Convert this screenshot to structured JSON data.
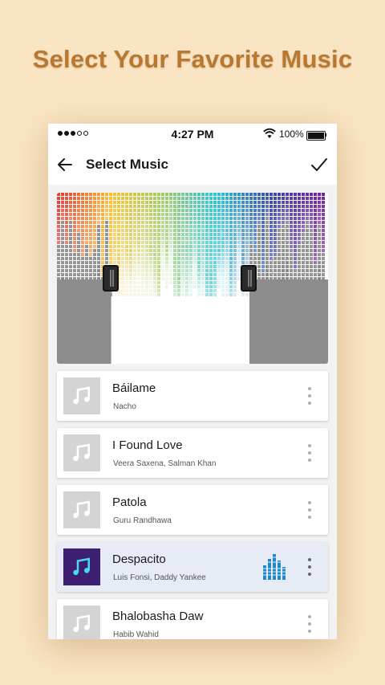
{
  "promo": {
    "title": "Select Your Favorite Music"
  },
  "status_bar": {
    "time": "4:27 PM",
    "battery": "100%",
    "signal_icon": "signal-dots",
    "wifi_icon": "wifi-icon",
    "battery_icon": "battery-icon"
  },
  "app_bar": {
    "title": "Select Music",
    "back_icon": "arrow-left-icon",
    "confirm_icon": "check-icon"
  },
  "waveform": {
    "selection_start": 0.2,
    "selection_end": 0.71,
    "colors": [
      "#e53935",
      "#fbc02d",
      "#9ccc65",
      "#26c6da",
      "#3949ab",
      "#7b1fa2"
    ]
  },
  "songs": [
    {
      "title": "Báilame",
      "artist": "Nacho",
      "playing": false
    },
    {
      "title": "I Found Love",
      "artist": "Veera Saxena, Salman Khan",
      "playing": false
    },
    {
      "title": "Patola",
      "artist": "Guru Randhawa",
      "playing": false
    },
    {
      "title": "Despacito",
      "artist": "Luis Fonsi, Daddy Yankee",
      "playing": true
    },
    {
      "title": "Bhalobasha Daw",
      "artist": "Habib Wahid",
      "playing": false
    }
  ],
  "colors": {
    "accent": "#1e88c8",
    "promo_text": "#b8782f",
    "background": "#f9e4c4"
  }
}
